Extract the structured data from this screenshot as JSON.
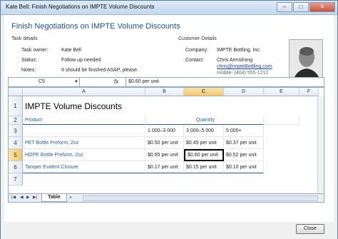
{
  "window": {
    "title": "Kate Bell: Finish Negotiations on IMPTE Volume Discounts",
    "minimize": "–",
    "maximize": "□",
    "close": "✕"
  },
  "heading": "Finish Negotiations on IMPTE Volume Discounts",
  "task": {
    "section": "Task details",
    "owner_label": "Task owner:",
    "owner": "Kate Bell",
    "status_label": "Status:",
    "status": "Follow up needed",
    "notes_label": "Notes:",
    "notes": "It should be finished ASAP, please."
  },
  "customer": {
    "section": "Customer Details",
    "company_label": "Company:",
    "company": "IMPTE Bottling, Inc.",
    "contact_label": "Contact:",
    "contact_name": "Chris Armstrong",
    "email": "chris@impteBottling.com",
    "mobile": "mobile: (404) 555-1212"
  },
  "formula_bar": {
    "name_box": "C5",
    "value": "$0.60 per unit"
  },
  "columns": [
    "A",
    "B",
    "C",
    "D",
    "E",
    "F"
  ],
  "rows": [
    "1",
    "2",
    "3",
    "4",
    "5",
    "6",
    "7"
  ],
  "cells": {
    "title": "IMPTE Volume Discounts",
    "product_hdr": "Product",
    "quantity_hdr": "Quantity",
    "q1": "1 000–3 000",
    "q2": "3 000–5 000",
    "q3": "5 000+",
    "r4_name": "PET Bottle Preform, 2oz",
    "r4_b": "$0.50 per unit",
    "r4_c": "$0.45 per unit",
    "r4_d": "$0.37 per unit",
    "r5_name": "HOPE Bottle Preform, 2oz",
    "r5_b": "$0.65 per unit",
    "r5_c": "$0.60 per unit",
    "r5_d": "$0.52 per unit",
    "r6_name": "Tamper Evident Closure",
    "r6_b": "$0.17 per unit",
    "r6_c": "$0.15 per unit",
    "r6_d": "$0.10 per unit"
  },
  "sheet_tab": "Table",
  "close_button": "Close",
  "colors": {
    "accent": "#1e4f91",
    "selection": "#f4c66a"
  }
}
